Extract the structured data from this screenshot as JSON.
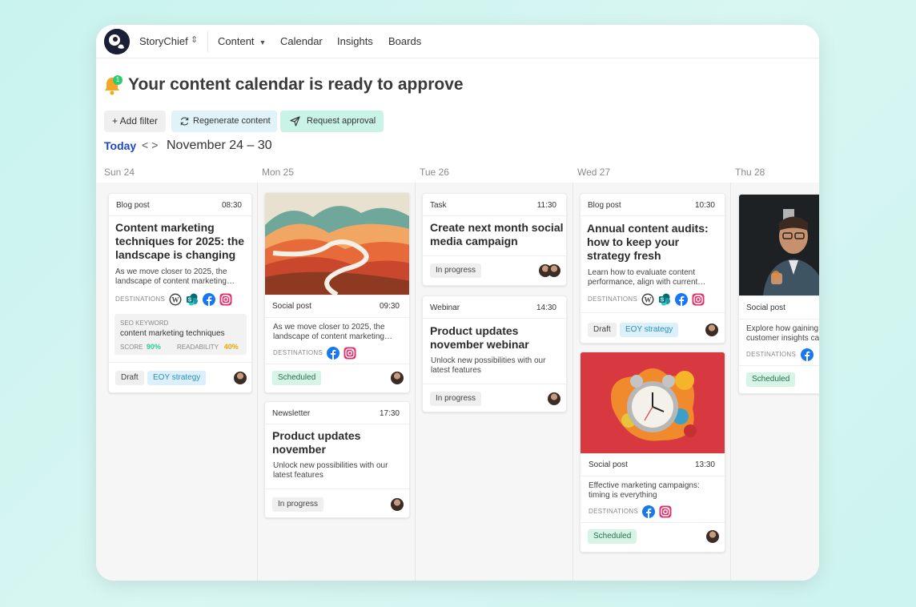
{
  "app": {
    "brand": "StoryChief",
    "nav": {
      "content": "Content",
      "calendar": "Calendar",
      "insights": "Insights",
      "boards": "Boards"
    }
  },
  "header": {
    "notification_count": "1",
    "title": "Your content calendar is ready to approve"
  },
  "toolbar": {
    "add_filter": "+ Add filter",
    "regenerate": "Regenerate content",
    "request_approval": "Request approval"
  },
  "date_nav": {
    "today": "Today",
    "prev": "<",
    "next": ">",
    "range": "November 24 – 30"
  },
  "days": [
    "Sun 24",
    "Mon 25",
    "Tue 26",
    "Wed 27",
    "Thu 28"
  ],
  "labels": {
    "destinations": "DESTINATIONS",
    "seo_keyword": "SEO KEYWORD",
    "score": "SCORE",
    "readability": "READABILITY"
  },
  "cards": {
    "sun_blog": {
      "type": "Blog post",
      "time": "08:30",
      "title": "Content marketing techniques for 2025: the landscape is changing",
      "desc": "As we move closer to 2025, the landscape of content marketing…",
      "seo_keyword": "content marketing techniques",
      "score": "90%",
      "readability": "40%",
      "status": "Draft",
      "tag": "EOY strategy"
    },
    "mon_social": {
      "type": "Social post",
      "time": "09:30",
      "desc": "As we move closer to 2025, the landscape of content marketing…",
      "status": "Scheduled"
    },
    "mon_newsletter": {
      "type": "Newsletter",
      "time": "17:30",
      "title": "Product updates november",
      "desc": "Unlock new possibilities with our latest features",
      "status": "In progress"
    },
    "tue_task": {
      "type": "Task",
      "time": "11:30",
      "title": "Create next month social media campaign",
      "status": "In progress"
    },
    "tue_webinar": {
      "type": "Webinar",
      "time": "14:30",
      "title": "Product updates november webinar",
      "desc": "Unlock new possibilities with our latest features",
      "status": "In progress"
    },
    "wed_blog": {
      "type": "Blog post",
      "time": "10:30",
      "title": "Annual content audits: how to keep your strategy fresh",
      "desc": "Learn how to evaluate content performance, align with current…",
      "status": "Draft",
      "tag": "EOY strategy"
    },
    "wed_social": {
      "type": "Social post",
      "time": "13:30",
      "desc": "Effective marketing campaigns: timing is everything",
      "status": "Scheduled"
    },
    "thu_social": {
      "type": "Social post",
      "desc": "Explore how gaining customer insights ca",
      "status": "Scheduled"
    }
  },
  "colors": {
    "accent_blue": "#1e47c9",
    "score_green": "#2ecc9a",
    "readability_orange": "#f0a500",
    "status_green_bg": "#d6f5e6",
    "tag_blue_bg": "#dbf0fa"
  },
  "icons": [
    "bell-icon",
    "refresh-icon",
    "send-icon",
    "wordpress-icon",
    "sharepoint-icon",
    "facebook-icon",
    "instagram-icon"
  ]
}
